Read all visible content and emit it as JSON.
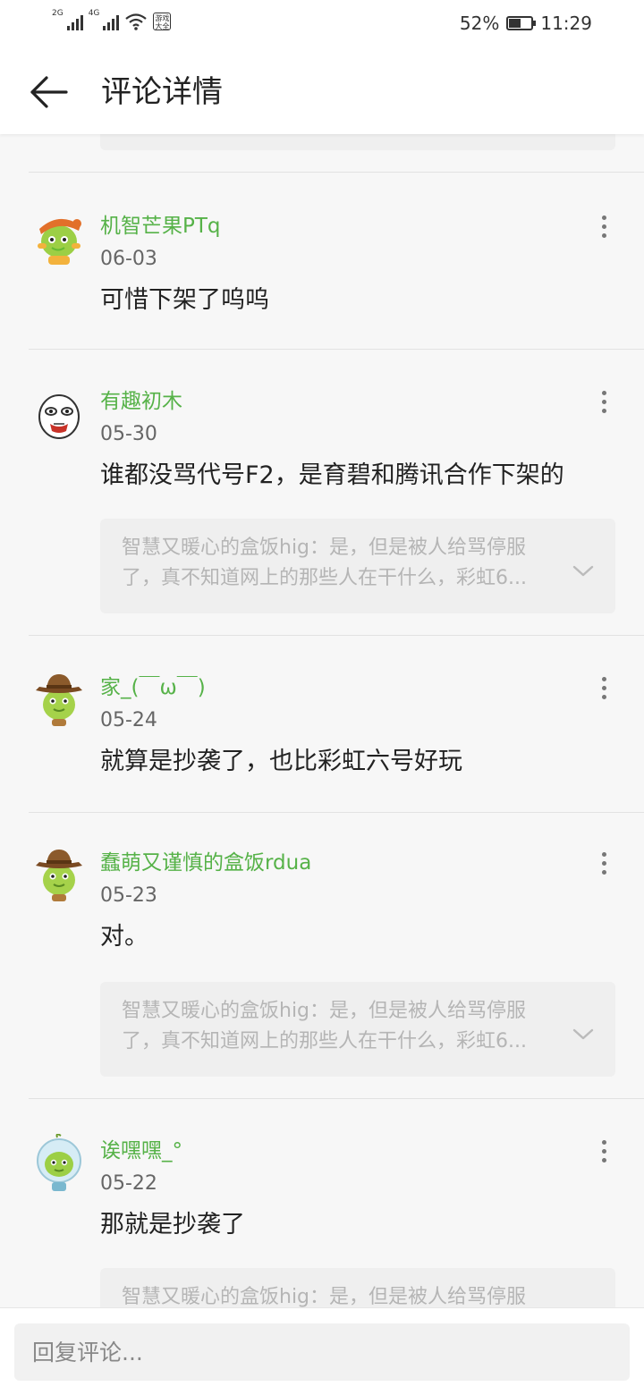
{
  "status_bar": {
    "network_1": "2G",
    "network_2": "4G",
    "badge_text": "游戏大全",
    "battery": "52%",
    "battery_level": 0.52,
    "time": "11:29"
  },
  "header": {
    "title": "评论详情",
    "back_icon": "arrow-left-icon"
  },
  "comments": [
    {
      "username": "机智芒果PTq",
      "date": "06-03",
      "text": "可惜下架了呜呜",
      "avatar": "mango-pirate-avatar"
    },
    {
      "username": "有趣初木",
      "date": "05-30",
      "text": "谁都没骂代号F2，是育碧和腾讯合作下架的",
      "avatar": "white-face-avatar",
      "quote": {
        "line1": "智慧又暖心的盒饭hig：是，但是被人给骂停服",
        "line2": "了，真不知道网上的那些人在干什么，彩虹6..."
      }
    },
    {
      "username": "家_(￣ω￣)",
      "date": "05-24",
      "text": "就算是抄袭了，也比彩虹六号好玩",
      "avatar": "cowboy-avatar"
    },
    {
      "username": "蠢萌又谨慎的盒饭rdua",
      "date": "05-23",
      "text": "对。",
      "avatar": "cowboy-avatar",
      "quote": {
        "line1": "智慧又暖心的盒饭hig：是，但是被人给骂停服",
        "line2": "了，真不知道网上的那些人在干什么，彩虹6..."
      }
    },
    {
      "username": "诶嘿嘿_°",
      "date": "05-22",
      "text": "那就是抄袭了",
      "avatar": "astronaut-avatar",
      "quote": {
        "line1": "智慧又暖心的盒饭hig：是，但是被人给骂停服",
        "line2": ""
      }
    }
  ],
  "footer": {
    "reply_placeholder": "回复评论..."
  },
  "colors": {
    "username": "#56b248",
    "background": "#f7f7f7",
    "quote_bg": "#efefef"
  }
}
